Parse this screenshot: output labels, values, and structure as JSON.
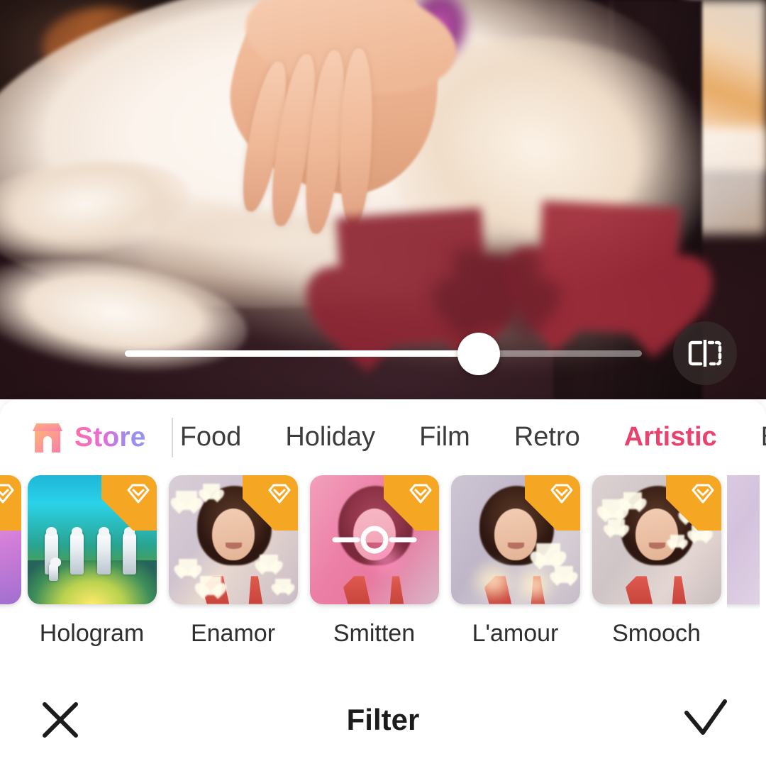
{
  "screen": {
    "title": "Filter",
    "accent_color": "#e8426e",
    "premium_badge_color": "#f5a623"
  },
  "preview": {
    "name": "photo-preview",
    "description": "Hand petting a white fluffy cat with red heart bokeh overlay",
    "compare_icon": "compare-before-after-icon",
    "slider": {
      "name": "filter-intensity-slider",
      "value": 68,
      "min": 0,
      "max": 100
    }
  },
  "store": {
    "label": "Store",
    "icon": "storefront-icon"
  },
  "tabs": [
    {
      "label": "Food",
      "active": false,
      "clipped": true
    },
    {
      "label": "Holiday",
      "active": false,
      "clipped": false
    },
    {
      "label": "Film",
      "active": false,
      "clipped": false
    },
    {
      "label": "Retro",
      "active": false,
      "clipped": false
    },
    {
      "label": "Artistic",
      "active": true,
      "clipped": false
    },
    {
      "label": "B&W",
      "active": false,
      "clipped": false
    }
  ],
  "filters": [
    {
      "label": "",
      "premium": true,
      "selected": false,
      "style": "t-pre",
      "edge": "left"
    },
    {
      "label": "Hologram",
      "premium": true,
      "selected": false,
      "style": "t-holo"
    },
    {
      "label": "Enamor",
      "premium": true,
      "selected": false,
      "style": "t-enamor"
    },
    {
      "label": "Smitten",
      "premium": true,
      "selected": true,
      "style": "t-smitten"
    },
    {
      "label": "L'amour",
      "premium": true,
      "selected": false,
      "style": "t-lamour"
    },
    {
      "label": "Smooch",
      "premium": true,
      "selected": false,
      "style": "t-smooch"
    },
    {
      "label": "",
      "premium": false,
      "selected": false,
      "style": "t-post",
      "edge": "right"
    }
  ],
  "actions": {
    "cancel": {
      "name": "cancel-button",
      "icon": "close-icon"
    },
    "title": "Filter",
    "confirm": {
      "name": "confirm-button",
      "icon": "check-icon"
    }
  }
}
